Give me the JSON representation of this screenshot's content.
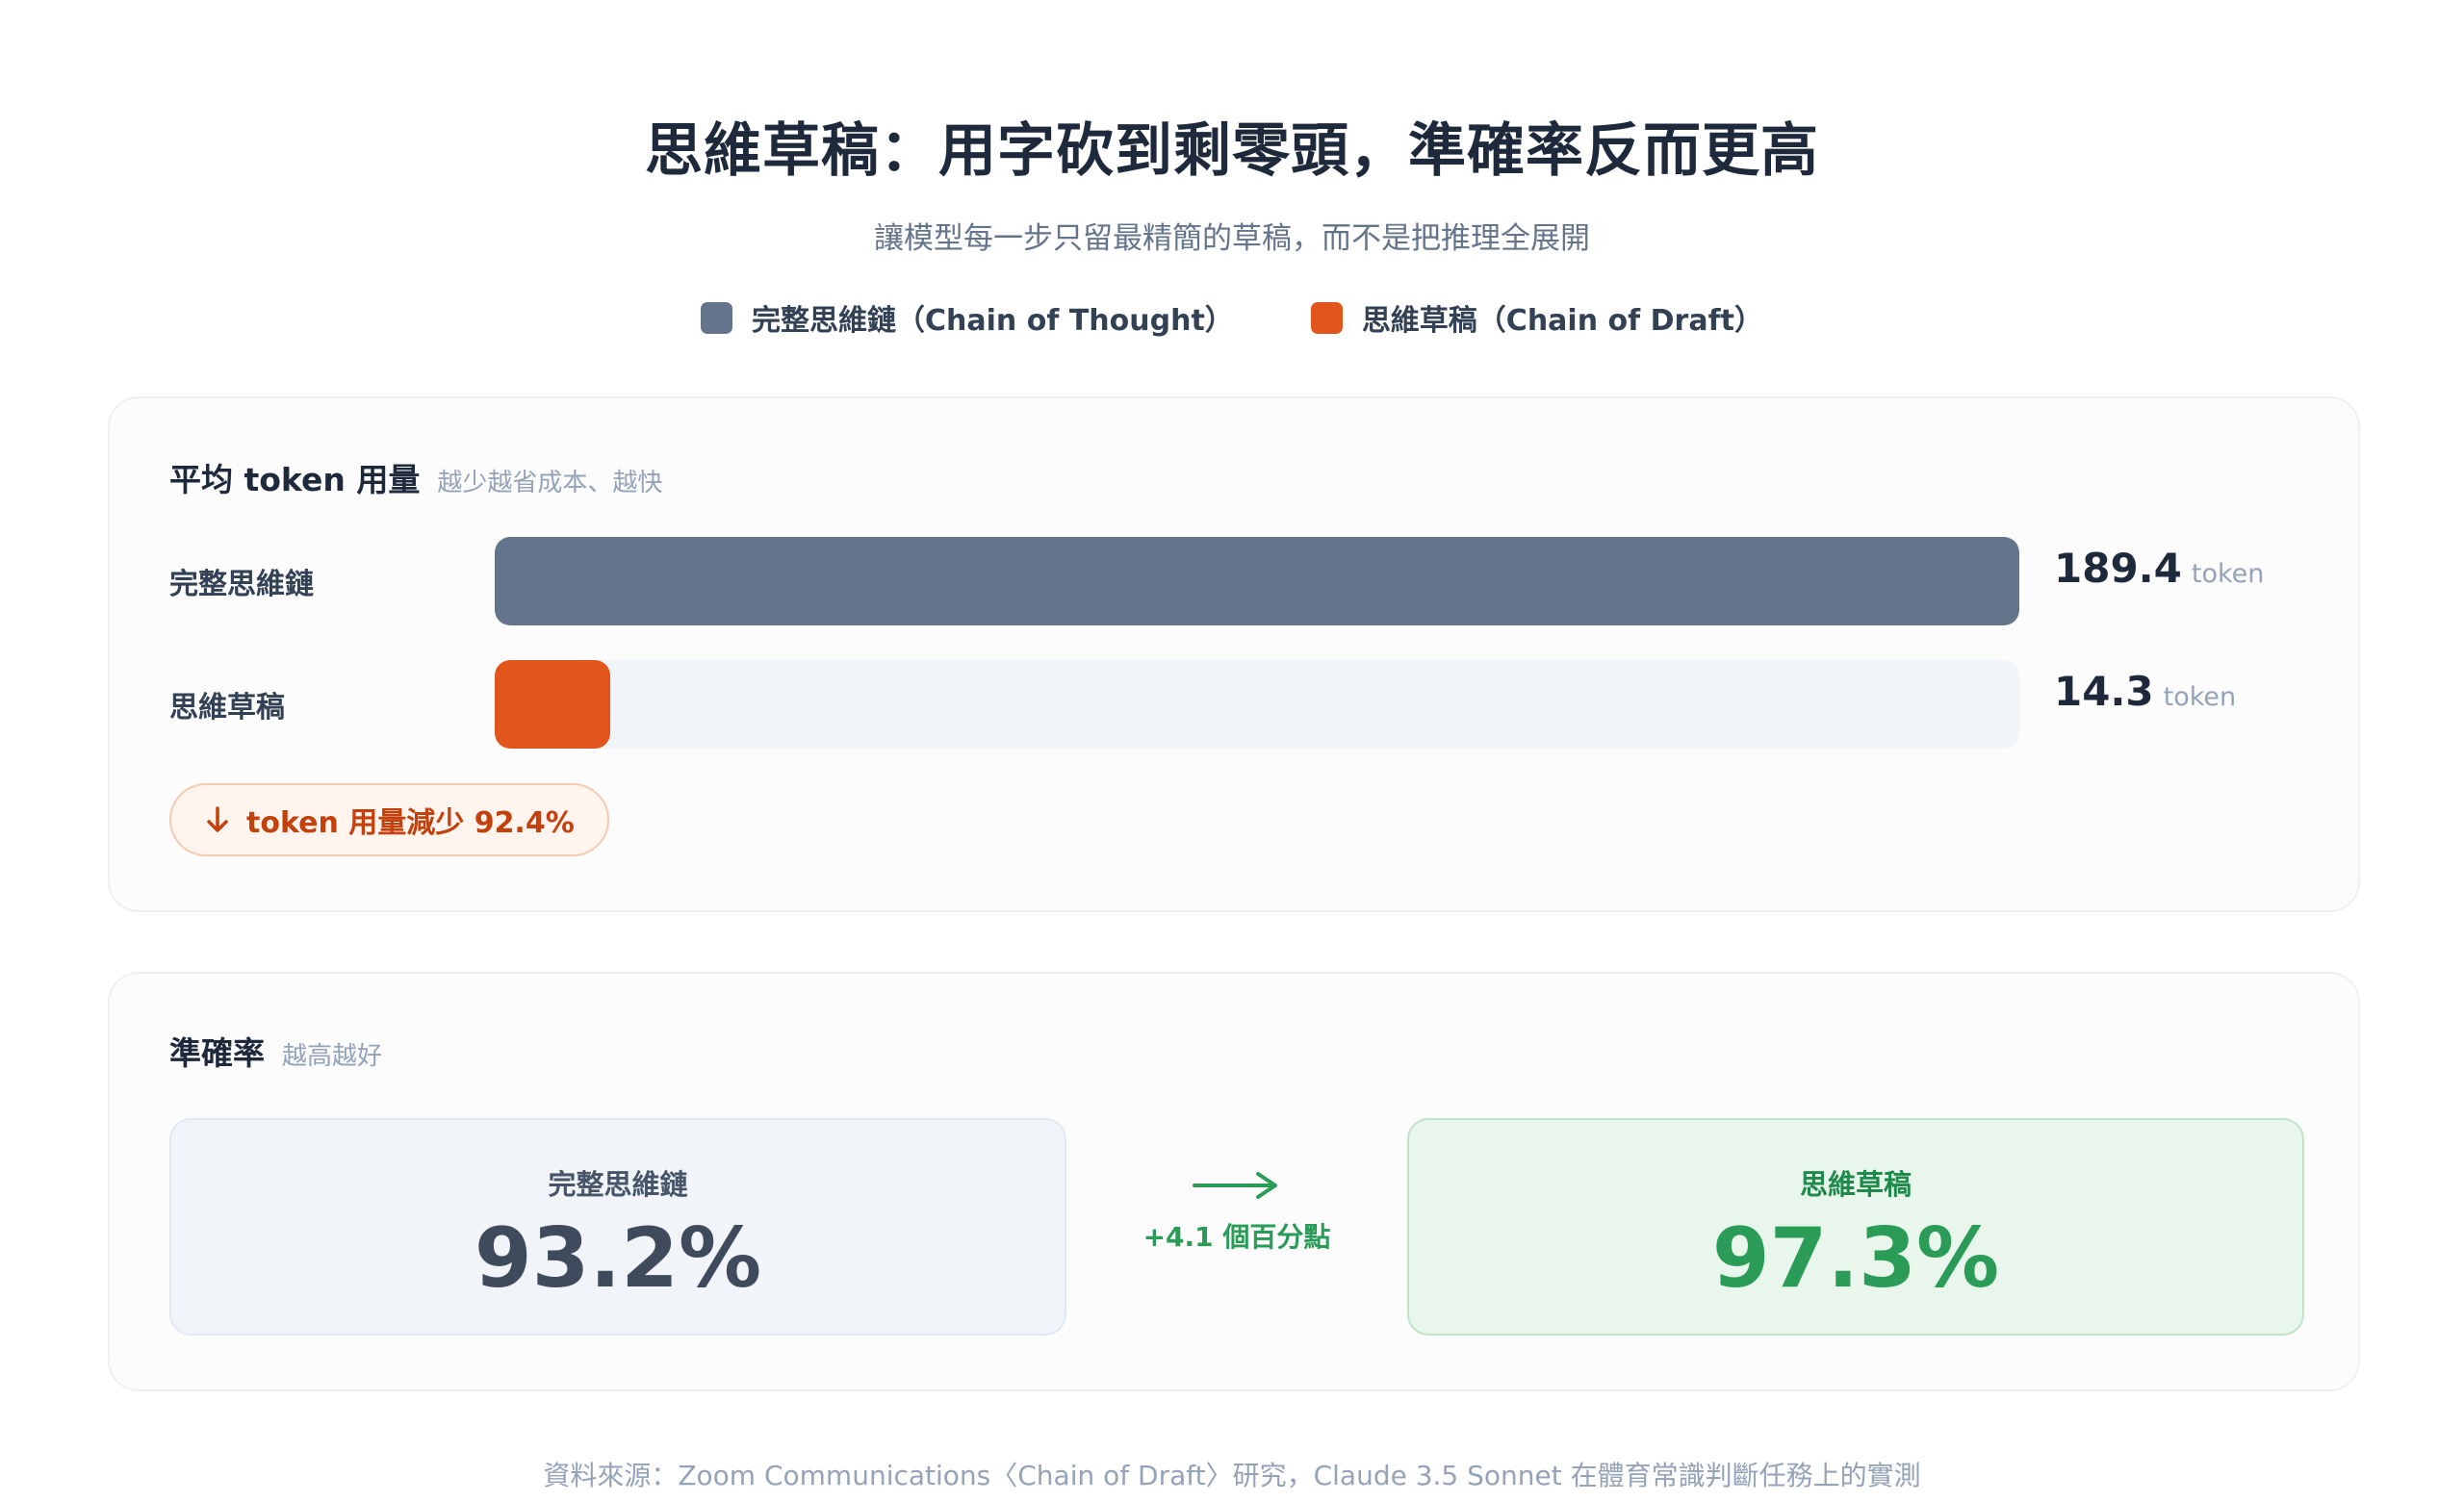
{
  "header": {
    "title": "思維草稿：用字砍到剩零頭，準確率反而更高",
    "subtitle": "讓模型每一步只留最精簡的草稿，而不是把推理全展開"
  },
  "legend": [
    {
      "label": "完整思維鏈（Chain of Thought）",
      "color": "#64748b"
    },
    {
      "label": "思維草稿（Chain of Draft）",
      "color": "#e2561e"
    }
  ],
  "token_card": {
    "title": "平均 token 用量",
    "note": "越少越省成本、越快",
    "reduction_label": "token 用量減少 92.4%",
    "reduction_icon": "arrow-down-icon"
  },
  "accuracy_card": {
    "title": "準確率",
    "note": "越高越好",
    "left_name": "完整思維鏈",
    "left_value": "93.2%",
    "right_name": "思維草稿",
    "right_value": "97.3%",
    "delta_label": "+4.1 個百分點",
    "delta_icon": "arrow-right-icon"
  },
  "chart_data": {
    "type": "bar",
    "orientation": "horizontal",
    "categories": [
      "完整思維鏈",
      "思維草稿"
    ],
    "values": [
      189.4,
      14.3
    ],
    "value_labels": [
      "189.4",
      "14.3"
    ],
    "unit": "token",
    "colors": [
      "#64748b",
      "#e2561e"
    ],
    "xlim": [
      0,
      189.4
    ],
    "grid": false
  },
  "footer": {
    "source": "資料來源：Zoom Communications〈Chain of Draft〉研究，Claude 3.5 Sonnet 在體育常識判斷任務上的實測"
  }
}
